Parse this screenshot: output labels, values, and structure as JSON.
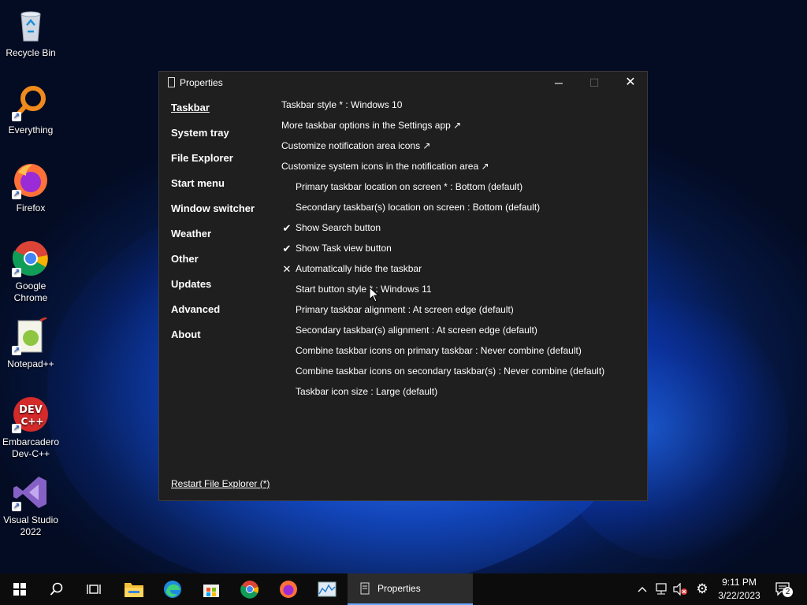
{
  "desktop": {
    "icons": [
      {
        "label": "Recycle Bin"
      },
      {
        "label": "Everything"
      },
      {
        "label": "Firefox"
      },
      {
        "label": "Google Chrome"
      },
      {
        "label": "Notepad++"
      },
      {
        "label": "Embarcadero Dev-C++"
      },
      {
        "label": "Visual Studio 2022"
      }
    ]
  },
  "window": {
    "title": "Properties",
    "nav": [
      {
        "label": "Taskbar",
        "active": true
      },
      {
        "label": "System tray"
      },
      {
        "label": "File Explorer"
      },
      {
        "label": "Start menu"
      },
      {
        "label": "Window switcher"
      },
      {
        "label": "Weather"
      },
      {
        "label": "Other"
      },
      {
        "label": "Updates"
      },
      {
        "label": "Advanced"
      },
      {
        "label": "About"
      }
    ],
    "restart_link": "Restart File Explorer (*)",
    "settings": [
      {
        "text": "Taskbar style * : Windows 10",
        "mark": ""
      },
      {
        "text": "More taskbar options in the Settings app ↗",
        "mark": ""
      },
      {
        "text": "Customize notification area icons ↗",
        "mark": ""
      },
      {
        "text": "Customize system icons in the notification area ↗",
        "mark": ""
      },
      {
        "text": "Primary taskbar location on screen * : Bottom (default)",
        "mark": ""
      },
      {
        "text": "Secondary taskbar(s) location on screen : Bottom (default)",
        "mark": ""
      },
      {
        "text": "Show Search button",
        "mark": "✔"
      },
      {
        "text": "Show Task view button",
        "mark": "✔"
      },
      {
        "text": "Automatically hide the taskbar",
        "mark": "✕"
      },
      {
        "text": "Start button style * : Windows 11",
        "mark": ""
      },
      {
        "text": "Primary taskbar alignment : At screen edge (default)",
        "mark": ""
      },
      {
        "text": "Secondary taskbar(s) alignment : At screen edge (default)",
        "mark": ""
      },
      {
        "text": "Combine taskbar icons on primary taskbar : Never combine (default)",
        "mark": ""
      },
      {
        "text": "Combine taskbar icons on secondary taskbar(s) : Never combine (default)",
        "mark": ""
      },
      {
        "text": "Taskbar icon size : Large (default)",
        "mark": ""
      }
    ]
  },
  "taskbar": {
    "active_app": "Properties",
    "time": "9:11 PM",
    "date": "3/22/2023",
    "notification_count": "2"
  },
  "colors": {
    "window_bg": "#1f1f1f",
    "taskbar_bg": "#0c0c0c",
    "accent": "#6aa6ff"
  }
}
